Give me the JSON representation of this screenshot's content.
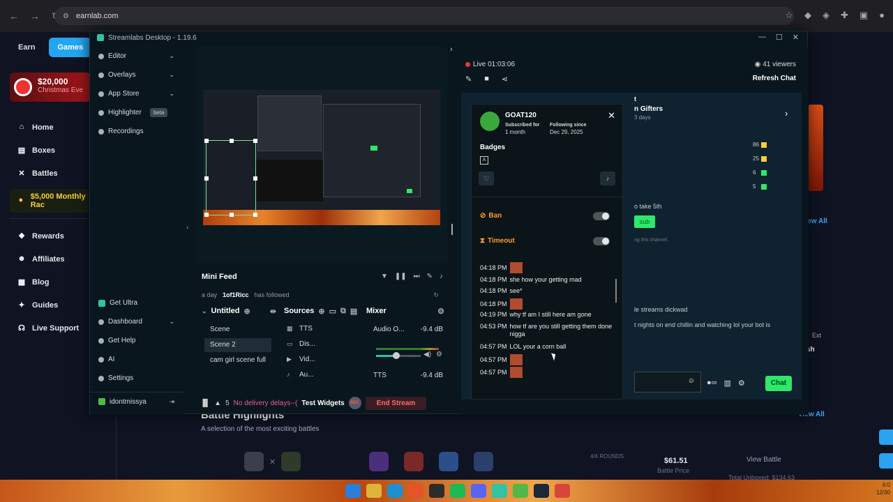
{
  "browser": {
    "url": "earnlab.com"
  },
  "site": {
    "nav": [
      "Earn",
      "Games"
    ],
    "banner": {
      "amount": "$20,000",
      "text": "Christmas Eve"
    },
    "sidebar": [
      {
        "label": "Home",
        "icon": "home-icon"
      },
      {
        "label": "Boxes",
        "icon": "box-icon"
      },
      {
        "label": "Battles",
        "icon": "swords-icon"
      },
      {
        "label": "$5,000 Monthly Rac",
        "icon": "coin-icon"
      },
      {
        "label": "Rewards",
        "icon": "gift-icon"
      },
      {
        "label": "Affiliates",
        "icon": "users-icon"
      },
      {
        "label": "Blog",
        "icon": "blog-icon"
      },
      {
        "label": "Guides",
        "icon": "guide-icon"
      },
      {
        "label": "Live Support",
        "icon": "headset-icon"
      }
    ],
    "battle_highlights": {
      "title": "Battle Highlights",
      "subtitle": "A selection of the most exciting battles"
    },
    "view_all": "View All",
    "rounds": "4/4 ROUNDS",
    "battle_price": {
      "value": "$61.51",
      "label": "Battle Price"
    },
    "view_battle": "View Battle",
    "total_unboxed": "Total Unboxed: $134.63",
    "ext_label": "Ext",
    "sh_label": "sh"
  },
  "streamlabs": {
    "title": "Streamlabs Desktop - 1.19.6",
    "sidebar": [
      {
        "label": "Editor",
        "chevron": true
      },
      {
        "label": "Overlays",
        "chevron": true
      },
      {
        "label": "App Store",
        "chevron": true
      },
      {
        "label": "Highlighter",
        "badge": "beta"
      },
      {
        "label": "Recordings"
      }
    ],
    "sidebar_bottom": [
      {
        "label": "Get Ultra"
      },
      {
        "label": "Dashboard",
        "chevron": true
      },
      {
        "label": "Get Help"
      },
      {
        "label": "AI"
      },
      {
        "label": "Settings"
      }
    ],
    "username": "idontmissya",
    "mini_feed": {
      "title": "Mini Feed",
      "time": "a day",
      "user": "1of1Ricc",
      "action": "has followed"
    },
    "scenes": {
      "title": "Untitled",
      "items": [
        "Scene",
        "Scene 2",
        "cam girl scene full"
      ],
      "active": 1
    },
    "sources": {
      "title": "Sources",
      "items": [
        {
          "label": "TTS",
          "icon": "audio-icon"
        },
        {
          "label": "Dis...",
          "icon": "display-icon"
        },
        {
          "label": "Vid...",
          "icon": "video-icon"
        },
        {
          "label": "Au...",
          "icon": "mic-icon"
        }
      ]
    },
    "mixer": {
      "title": "Mixer",
      "rows": [
        {
          "name": "Audio O...",
          "db": "-9.4 dB",
          "volume_fraction": 0.45
        },
        {
          "name": "TTS",
          "db": "-9.4 dB"
        }
      ]
    },
    "footer": {
      "count": "5",
      "delay": "No delivery delays--(",
      "test_widgets": "Test Widgets",
      "rec": "REC",
      "end_stream": "End Stream"
    }
  },
  "chat": {
    "live_time": "Live 01:03:06",
    "viewers": "41 viewers",
    "refresh": "Refresh Chat",
    "right_header": "t",
    "gifters_title": "n Gifters",
    "gifters_days": "3 days",
    "gift_counts": [
      "86",
      "25",
      "6",
      "5"
    ],
    "right_lines": [
      "o take 5th",
      "ng this channel.",
      "le streams dickwad",
      "t nights on end chillin and watching lol your bot is"
    ],
    "sub_btn": "sub",
    "chat_btn": "Chat",
    "user_card": {
      "name": "GOAT120",
      "subscribed_label": "Subscribed for",
      "subscribed_value": "1 month",
      "following_label": "Following since",
      "following_value": "Dec 29, 2025",
      "badges_label": "Badges",
      "ban": "Ban",
      "timeout": "Timeout"
    },
    "messages": [
      {
        "time": "04:18 PM",
        "text": "",
        "emote": true
      },
      {
        "time": "04:18 PM",
        "text": "she how your getting mad"
      },
      {
        "time": "04:18 PM",
        "text": "see*"
      },
      {
        "time": "04:18 PM",
        "text": "",
        "emote": true
      },
      {
        "time": "04:19 PM",
        "text": "why tf am I still here am gone"
      },
      {
        "time": "04:53 PM",
        "text": "how tf are you still getting them done nigga"
      },
      {
        "time": "04:57 PM",
        "text": "LOL your a corn ball"
      },
      {
        "time": "04:57 PM",
        "text": "",
        "emote": true
      },
      {
        "time": "04:57 PM",
        "text": "",
        "emote": true
      }
    ]
  },
  "taskbar": {
    "time": "6:0",
    "date": "12/30"
  },
  "colors": {
    "accent": "#31c3a2",
    "brand_blue": "#23a6f0",
    "chat_green": "#2ee86a",
    "end_stream": "#ff6a6a"
  }
}
